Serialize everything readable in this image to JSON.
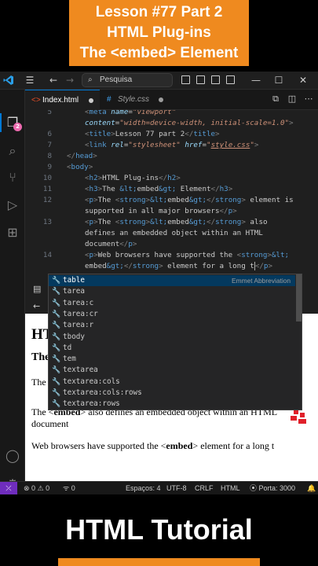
{
  "banner": {
    "line1": "Lesson #77 Part 2",
    "line2": "HTML Plug-ins",
    "line3": "The <embed> Element"
  },
  "titlebar": {
    "search_placeholder": "Pesquisa",
    "icons": [
      "menu-icon",
      "arrow-left-icon",
      "arrow-right-icon",
      "search-icon",
      "layout-icons",
      "minimize-icon",
      "maximize-icon",
      "close-icon"
    ]
  },
  "activity": {
    "explorer_badge": "2",
    "icons": [
      "explorer-icon",
      "search-icon",
      "source-control-icon",
      "run-debug-icon",
      "extensions-icon",
      "account-icon",
      "settings-gear-icon"
    ]
  },
  "tabs": [
    {
      "label": "Index.html",
      "icon": "html-file-icon"
    },
    {
      "label": "Style.css",
      "icon": "css-file-icon"
    }
  ],
  "editor": {
    "lines": [
      {
        "n": "5",
        "text": "<meta name=\"viewport\""
      },
      {
        "n": "",
        "text": "content=\"width=device-width, initial-scale=1.0\">"
      },
      {
        "n": "6",
        "text": "<title>Lesson 77 part 2</title>"
      },
      {
        "n": "7",
        "text": "<link rel=\"stylesheet\" href=\"style.css\">"
      },
      {
        "n": "8",
        "text": "</head>"
      },
      {
        "n": "9",
        "text": "<body>"
      },
      {
        "n": "10",
        "text": "<h2>HTML Plug-ins</h2>"
      },
      {
        "n": "11",
        "text": "<h3>The &lt;embed&gt; Element</h3>"
      },
      {
        "n": "12",
        "text": "<p>The <strong>&lt;embed&gt;</strong> element is"
      },
      {
        "n": "",
        "text": "supported in all major browsers</p>"
      },
      {
        "n": "13",
        "text": "<p>The <strong>&lt;embed&gt;</strong> also"
      },
      {
        "n": "",
        "text": "defines an embedded object within an HTML"
      },
      {
        "n": "",
        "text": "document</p>"
      },
      {
        "n": "14",
        "text": "<p>Web browsers have supported the <strong>&lt;"
      },
      {
        "n": "",
        "text": "embed&gt;</strong> element for a long t</p>"
      }
    ]
  },
  "suggestions": {
    "items": [
      "table",
      "tarea",
      "tarea:c",
      "tarea:cr",
      "tarea:r",
      "tbody",
      "td",
      "tem",
      "textarea",
      "textarea:cols",
      "textarea:cols:rows",
      "textarea:rows"
    ],
    "active_detail": "Emmet Abbreviation"
  },
  "preview": {
    "h2_partial": "HT",
    "h3_partial": "The",
    "p1_partial": "The",
    "p2_prefix": "The <",
    "p2_strong": "embed",
    "p2_suffix": "> also defines an embedded object within an HTML",
    "p2_line2": "document",
    "p3_prefix": "Web browsers have supported the <",
    "p3_strong": "embed",
    "p3_suffix": "> element for a long t"
  },
  "statusbar": {
    "errors": "0",
    "warnings": "0",
    "ports": "0",
    "spaces": "Espaços: 4",
    "encoding": "UTF-8",
    "eol": "CRLF",
    "language": "HTML",
    "port": "Porta: 3000"
  },
  "caption": "HTML Tutorial",
  "colors": {
    "banner": "#ef8a1f",
    "accent": "#0078d4",
    "remote": "#6f2dbd"
  }
}
